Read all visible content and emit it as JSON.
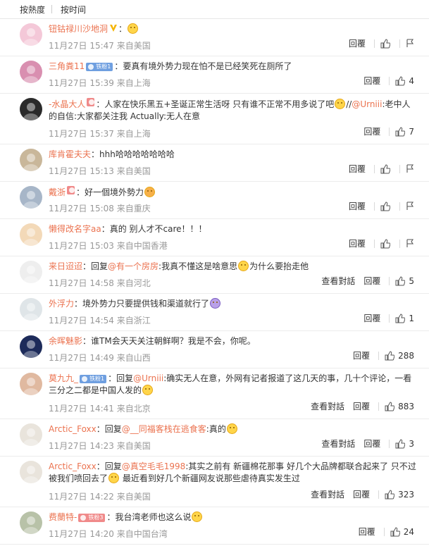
{
  "sort": {
    "hot": "按熱度",
    "time": "按时间"
  },
  "actions": {
    "reply": "回覆",
    "dialog": "查看對話"
  },
  "colors": {
    "username": "#eb7350",
    "meta": "#999999",
    "text": "#333333"
  },
  "comments": [
    {
      "user": "钮钴禄川沙地洞",
      "badge": null,
      "vip": true,
      "head_emoji": "smile-emoji",
      "content": [],
      "time": "11月27日 15:47 来自美国",
      "dialog": false,
      "likes": null,
      "report": true,
      "avatar_color": "#f4c8d8"
    },
    {
      "user": "三角粪11",
      "badge": "铁粉1",
      "vip": false,
      "content": [
        {
          "t": "text",
          "v": "：要真有境外势力现在怕不是已经笑死在厕所了"
        }
      ],
      "time": "11月27日 15:39 来自上海",
      "dialog": false,
      "likes": "4",
      "report": false,
      "avatar_color": "#d98fb0"
    },
    {
      "user": "-水晶大人",
      "badge_pink": true,
      "vip": false,
      "content": [
        {
          "t": "text",
          "v": "：人家在快乐黑五+圣诞正常生活呀 只有谁不正常不用多说了吧"
        },
        {
          "t": "emoji",
          "v": "smile"
        },
        {
          "t": "text",
          "v": "//"
        },
        {
          "t": "mention",
          "v": "@Urniii"
        },
        {
          "t": "text",
          "v": ":老中人的自信:大家都关注我 Actually:无人在意"
        }
      ],
      "time": "11月27日 15:37 来自上海",
      "dialog": false,
      "likes": "7",
      "report": false,
      "avatar_color": "#2a2a2a"
    },
    {
      "user": "库肯霍夫夫",
      "badge": null,
      "vip": false,
      "content": [
        {
          "t": "text",
          "v": "：hhh哈哈哈哈哈哈哈"
        }
      ],
      "time": "11月27日 15:13 来自美国",
      "dialog": false,
      "likes": null,
      "report": true,
      "avatar_color": "#c9b79a"
    },
    {
      "user": "戴浙",
      "badge_pink": true,
      "vip": false,
      "content": [
        {
          "t": "text",
          "v": "：好一個境外勢力"
        },
        {
          "t": "emoji",
          "v": "angry"
        }
      ],
      "time": "11月27日 15:08 来自重庆",
      "dialog": false,
      "likes": null,
      "report": true,
      "avatar_color": "#a7b6c8"
    },
    {
      "user": "懒得改名字aa",
      "badge": null,
      "vip": false,
      "content": [
        {
          "t": "text",
          "v": "：真的 别人才不care！！！"
        }
      ],
      "time": "11月27日 15:03 来自中国香港",
      "dialog": false,
      "likes": null,
      "report": true,
      "avatar_color": "#f3d9b8"
    },
    {
      "user": "来日迢迢",
      "badge": null,
      "vip": false,
      "content": [
        {
          "t": "text",
          "v": "：回复"
        },
        {
          "t": "mention",
          "v": "@有一个房房"
        },
        {
          "t": "text",
          "v": ":我真不懂这是啥意思"
        },
        {
          "t": "emoji",
          "v": "cry"
        },
        {
          "t": "text",
          "v": "为什么要抬走他"
        }
      ],
      "time": "11月27日 14:58 来自河北",
      "dialog": true,
      "likes": "5",
      "report": false,
      "avatar_color": "#eeeeee"
    },
    {
      "user": "外浮力",
      "badge": null,
      "vip": false,
      "content": [
        {
          "t": "text",
          "v": "：境外势力只要提供钱和渠道就行了"
        },
        {
          "t": "emoji",
          "v": "purple"
        }
      ],
      "time": "11月27日 14:54 来自浙江",
      "dialog": false,
      "likes": "1",
      "report": false,
      "avatar_color": "#dfe5e8"
    },
    {
      "user": "余晖魅影",
      "badge": null,
      "vip": false,
      "content": [
        {
          "t": "text",
          "v": "：谁TM会天天关注朝鲜啊？我是不会，你呢。"
        }
      ],
      "time": "11月27日 14:49 来自山西",
      "dialog": false,
      "likes": "288",
      "report": false,
      "avatar_color": "#1d2b5a"
    },
    {
      "user": "莫九九_",
      "badge": "铁粉1",
      "vip": false,
      "content": [
        {
          "t": "text",
          "v": "：回复"
        },
        {
          "t": "mention",
          "v": "@Urniii"
        },
        {
          "t": "text",
          "v": ":确实无人在意，外网有记者报道了这几天的事，几十个评论，一看三分之二都是中国人发的"
        },
        {
          "t": "emoji",
          "v": "smile"
        }
      ],
      "time": "11月27日 14:41 来自北京",
      "dialog": true,
      "likes": "883",
      "report": false,
      "avatar_color": "#e0b9a0"
    },
    {
      "user": "Arctic_Foxx",
      "badge": null,
      "vip": false,
      "content": [
        {
          "t": "text",
          "v": "：回复"
        },
        {
          "t": "mention",
          "v": "@__同福客栈在逃食客"
        },
        {
          "t": "text",
          "v": ":真的"
        },
        {
          "t": "emoji",
          "v": "smile"
        }
      ],
      "time": "11月27日 14:23 来自美国",
      "dialog": true,
      "likes": "3",
      "report": false,
      "avatar_color": "#e9e4dc"
    },
    {
      "user": "Arctic_Foxx",
      "badge": null,
      "vip": false,
      "content": [
        {
          "t": "text",
          "v": "：回复"
        },
        {
          "t": "mention",
          "v": "@真空毛毛1998"
        },
        {
          "t": "text",
          "v": ":其实之前有 新疆棉花那事 好几个大品牌都联合起来了 只不过被我们喷回去了"
        },
        {
          "t": "emoji",
          "v": "smile"
        },
        {
          "t": "text",
          "v": " 最近看到好几个新疆网友说那些虐待真实发生过"
        }
      ],
      "time": "11月27日 14:22 来自美国",
      "dialog": true,
      "likes": "323",
      "report": false,
      "avatar_color": "#e9e4dc"
    },
    {
      "user": "费蘭特-",
      "badge_pink3": "铁粉3",
      "vip": false,
      "content": [
        {
          "t": "text",
          "v": "：我台湾老师也这么说"
        },
        {
          "t": "emoji",
          "v": "smile"
        }
      ],
      "time": "11月27日 14:20 来自中国台湾",
      "dialog": false,
      "likes": "24",
      "report": false,
      "avatar_color": "#b8c2a8"
    }
  ]
}
